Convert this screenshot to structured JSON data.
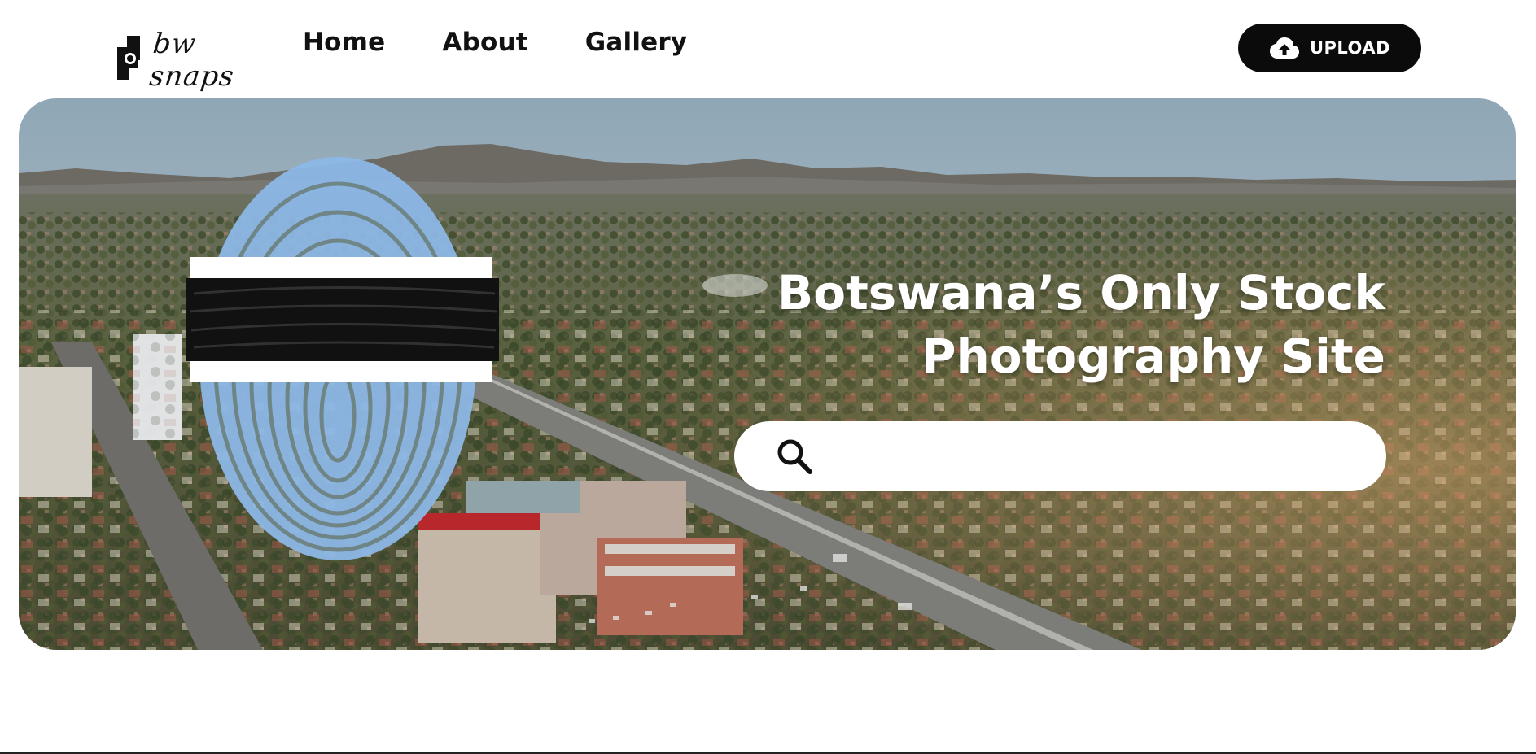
{
  "header": {
    "logo_text": "bw snaps",
    "nav": [
      {
        "label": "Home"
      },
      {
        "label": "About"
      },
      {
        "label": "Gallery"
      }
    ],
    "upload_label": "UPLOAD",
    "upload_icon": "cloud-upload-icon"
  },
  "hero": {
    "headline_line1": "Botswana’s Only Stock",
    "headline_line2": "Photography Site",
    "search": {
      "icon": "search-icon",
      "placeholder": ""
    }
  },
  "colors": {
    "button_bg": "#0b0b0b",
    "fingerprint_blue": "#8cb7e6",
    "fingerprint_black": "#111111"
  }
}
